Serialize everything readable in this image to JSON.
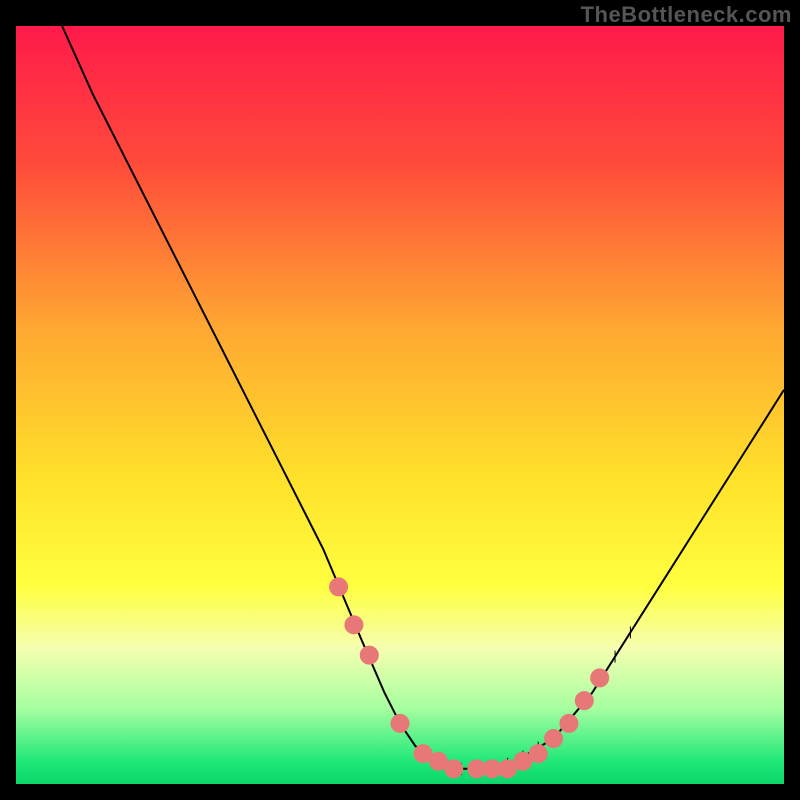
{
  "watermark": "TheBottleneck.com",
  "colors": {
    "frame": "#000000",
    "curve": "#000000",
    "marker_fill": "#e87777",
    "marker_stroke": "#e87777",
    "gradient_stops": [
      {
        "offset": 0.0,
        "color": "#ff1a4b"
      },
      {
        "offset": 0.18,
        "color": "#ff4a3a"
      },
      {
        "offset": 0.4,
        "color": "#ffa832"
      },
      {
        "offset": 0.6,
        "color": "#ffe22a"
      },
      {
        "offset": 0.74,
        "color": "#ffff40"
      },
      {
        "offset": 0.82,
        "color": "#f6ffb0"
      },
      {
        "offset": 0.9,
        "color": "#a6ffa0"
      },
      {
        "offset": 0.97,
        "color": "#20e878"
      },
      {
        "offset": 1.0,
        "color": "#0bd66a"
      }
    ]
  },
  "chart_data": {
    "type": "line",
    "title": "",
    "xlabel": "",
    "ylabel": "",
    "xlim": [
      0,
      100
    ],
    "ylim": [
      0,
      100
    ],
    "grid": false,
    "series": [
      {
        "name": "bottleneck-curve",
        "x": [
          6,
          10,
          15,
          20,
          25,
          30,
          35,
          40,
          45,
          48,
          50,
          52,
          55,
          58,
          60,
          62,
          65,
          70,
          75,
          80,
          85,
          90,
          95,
          100
        ],
        "y": [
          100,
          91,
          81,
          71,
          61,
          51,
          41,
          31,
          19,
          12,
          8,
          5,
          3,
          2,
          2,
          2,
          3,
          6,
          12,
          20,
          28,
          36,
          44,
          52
        ]
      }
    ],
    "markers": {
      "name": "highlighted-points",
      "x": [
        42,
        44,
        46,
        50,
        53,
        55,
        57,
        60,
        62,
        64,
        66,
        68,
        70,
        72,
        74,
        76
      ],
      "y": [
        26,
        21,
        17,
        8,
        4,
        3,
        2,
        2,
        2,
        2,
        3,
        4,
        6,
        8,
        11,
        14
      ]
    },
    "ticks": {
      "x": [
        58,
        60,
        62,
        64,
        66,
        68,
        70,
        72,
        74,
        76,
        78,
        80
      ],
      "tick_height": 2
    }
  }
}
